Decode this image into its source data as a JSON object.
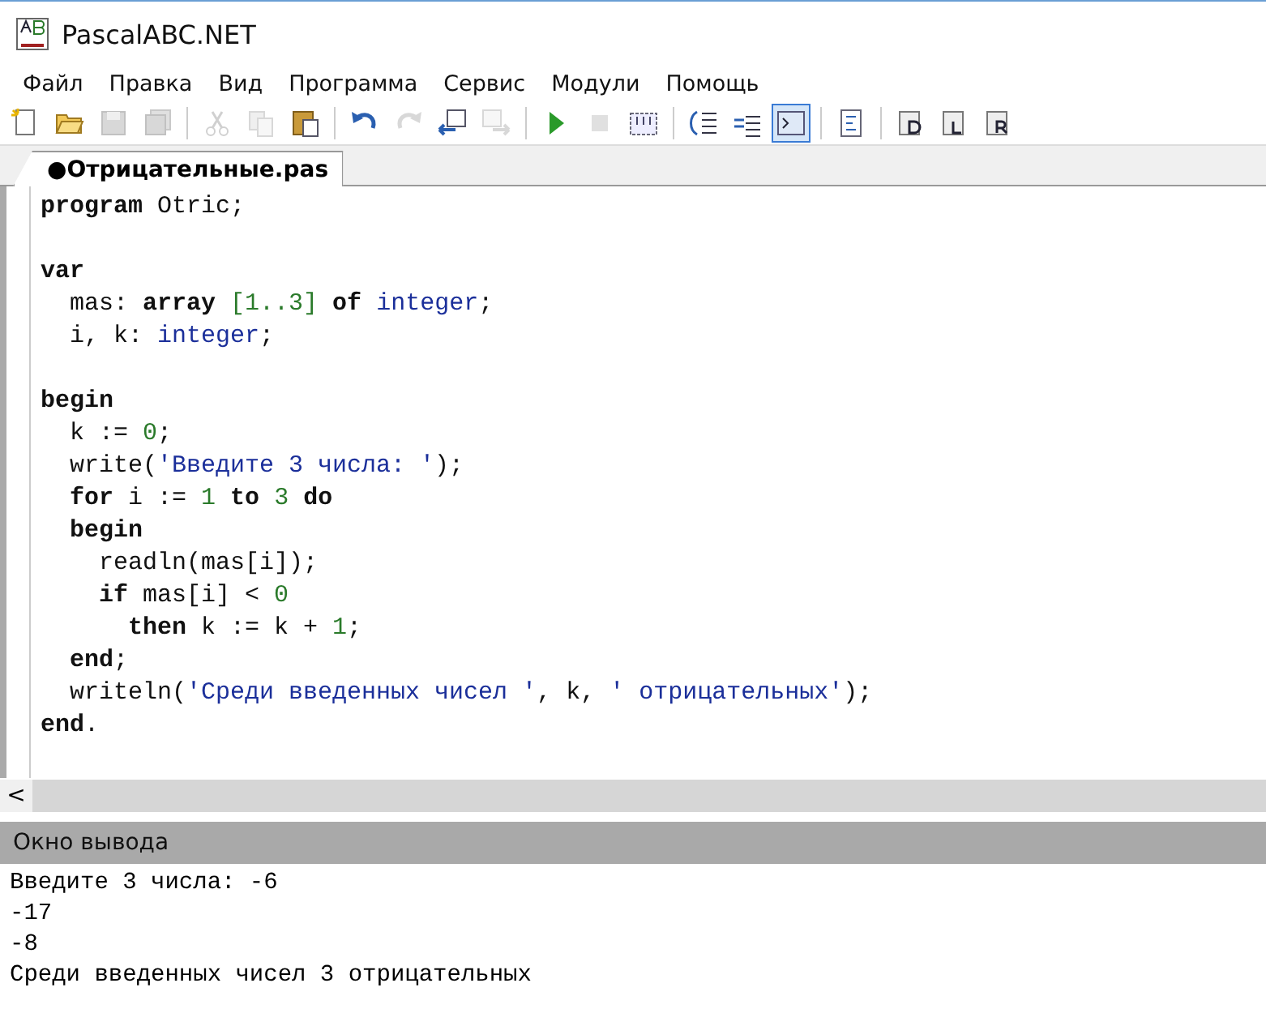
{
  "window": {
    "title": "PascalABC.NET"
  },
  "menu": [
    "Файл",
    "Правка",
    "Вид",
    "Программа",
    "Сервис",
    "Модули",
    "Помощь"
  ],
  "toolbar": [
    [
      {
        "kind": "new",
        "disabled": false,
        "selected": false
      },
      {
        "kind": "open",
        "disabled": false,
        "selected": false
      },
      {
        "kind": "save",
        "disabled": true,
        "selected": false
      },
      {
        "kind": "save-all",
        "disabled": true,
        "selected": false
      }
    ],
    [
      {
        "kind": "cut",
        "disabled": true,
        "selected": false
      },
      {
        "kind": "copy",
        "disabled": true,
        "selected": false
      },
      {
        "kind": "paste",
        "disabled": false,
        "selected": false
      }
    ],
    [
      {
        "kind": "undo",
        "disabled": false,
        "selected": false
      },
      {
        "kind": "redo",
        "disabled": true,
        "selected": false
      },
      {
        "kind": "back",
        "disabled": false,
        "selected": false
      },
      {
        "kind": "forward",
        "disabled": true,
        "selected": false
      }
    ],
    [
      {
        "kind": "run",
        "disabled": false,
        "selected": false
      },
      {
        "kind": "stop",
        "disabled": true,
        "selected": false
      },
      {
        "kind": "compile",
        "disabled": false,
        "selected": false
      }
    ],
    [
      {
        "kind": "indent",
        "disabled": false,
        "selected": false
      },
      {
        "kind": "outdent",
        "disabled": false,
        "selected": false
      },
      {
        "kind": "console",
        "disabled": false,
        "selected": true
      }
    ],
    [
      {
        "kind": "format",
        "disabled": false,
        "selected": false
      }
    ],
    [
      {
        "kind": "doc-d",
        "disabled": false,
        "selected": false
      },
      {
        "kind": "doc-l",
        "disabled": false,
        "selected": false
      },
      {
        "kind": "doc-r",
        "disabled": false,
        "selected": false
      }
    ]
  ],
  "tabs": [
    {
      "label": "●Отрицательные.pas",
      "selected": true
    }
  ],
  "editor": {
    "lines": [
      {
        "kind": "code",
        "tokens": [
          {
            "kind": "kw",
            "text": "program"
          },
          {
            "kind": "plain",
            "text": " Otric;"
          }
        ]
      },
      {
        "kind": "blank"
      },
      {
        "kind": "code",
        "tokens": [
          {
            "kind": "kw",
            "text": "var"
          }
        ]
      },
      {
        "kind": "code",
        "tokens": [
          {
            "kind": "plain",
            "text": "  mas: "
          },
          {
            "kind": "kw",
            "text": "array"
          },
          {
            "kind": "num",
            "text": " [1..3]"
          },
          {
            "kind": "kw",
            "text": " of"
          },
          {
            "kind": "type",
            "text": " integer"
          },
          {
            "kind": "plain",
            "text": ";"
          }
        ]
      },
      {
        "kind": "code",
        "tokens": [
          {
            "kind": "plain",
            "text": "  i, k: "
          },
          {
            "kind": "type",
            "text": "integer"
          },
          {
            "kind": "plain",
            "text": ";"
          }
        ]
      },
      {
        "kind": "blank"
      },
      {
        "kind": "code",
        "tokens": [
          {
            "kind": "kw",
            "text": "begin"
          }
        ]
      },
      {
        "kind": "code",
        "tokens": [
          {
            "kind": "plain",
            "text": "  k := "
          },
          {
            "kind": "num",
            "text": "0"
          },
          {
            "kind": "plain",
            "text": ";"
          }
        ]
      },
      {
        "kind": "code",
        "tokens": [
          {
            "kind": "plain",
            "text": "  write("
          },
          {
            "kind": "str",
            "text": "'Введите 3 числа: '"
          },
          {
            "kind": "plain",
            "text": ");"
          }
        ]
      },
      {
        "kind": "code",
        "tokens": [
          {
            "kind": "kw",
            "text": "  for"
          },
          {
            "kind": "plain",
            "text": " i := "
          },
          {
            "kind": "num",
            "text": "1"
          },
          {
            "kind": "kw",
            "text": " to"
          },
          {
            "kind": "num",
            "text": " 3"
          },
          {
            "kind": "kw",
            "text": " do"
          }
        ]
      },
      {
        "kind": "code",
        "tokens": [
          {
            "kind": "kw",
            "text": "  begin"
          }
        ]
      },
      {
        "kind": "code",
        "tokens": [
          {
            "kind": "plain",
            "text": "    readln(mas[i]);"
          }
        ]
      },
      {
        "kind": "code",
        "tokens": [
          {
            "kind": "kw",
            "text": "    if"
          },
          {
            "kind": "plain",
            "text": " mas[i] < "
          },
          {
            "kind": "num",
            "text": "0"
          }
        ]
      },
      {
        "kind": "code",
        "tokens": [
          {
            "kind": "kw",
            "text": "      then"
          },
          {
            "kind": "plain",
            "text": " k := k + "
          },
          {
            "kind": "num",
            "text": "1"
          },
          {
            "kind": "plain",
            "text": ";"
          }
        ]
      },
      {
        "kind": "code",
        "tokens": [
          {
            "kind": "kw",
            "text": "  end"
          },
          {
            "kind": "plain",
            "text": ";"
          }
        ]
      },
      {
        "kind": "code",
        "tokens": [
          {
            "kind": "plain",
            "text": "  writeln("
          },
          {
            "kind": "str",
            "text": "'Среди введенных чисел '"
          },
          {
            "kind": "plain",
            "text": ", k, "
          },
          {
            "kind": "str",
            "text": "' отрицательных'"
          },
          {
            "kind": "plain",
            "text": ");"
          }
        ]
      },
      {
        "kind": "code",
        "tokens": [
          {
            "kind": "kw",
            "text": "end"
          },
          {
            "kind": "plain",
            "text": "."
          }
        ]
      }
    ]
  },
  "scrollbar": {
    "arrow": "<"
  },
  "output": {
    "title": "Окно вывода",
    "lines": [
      "Введите 3 числа: -6",
      "-17",
      "-8",
      "Среди введенных чисел 3 отрицательных"
    ]
  }
}
